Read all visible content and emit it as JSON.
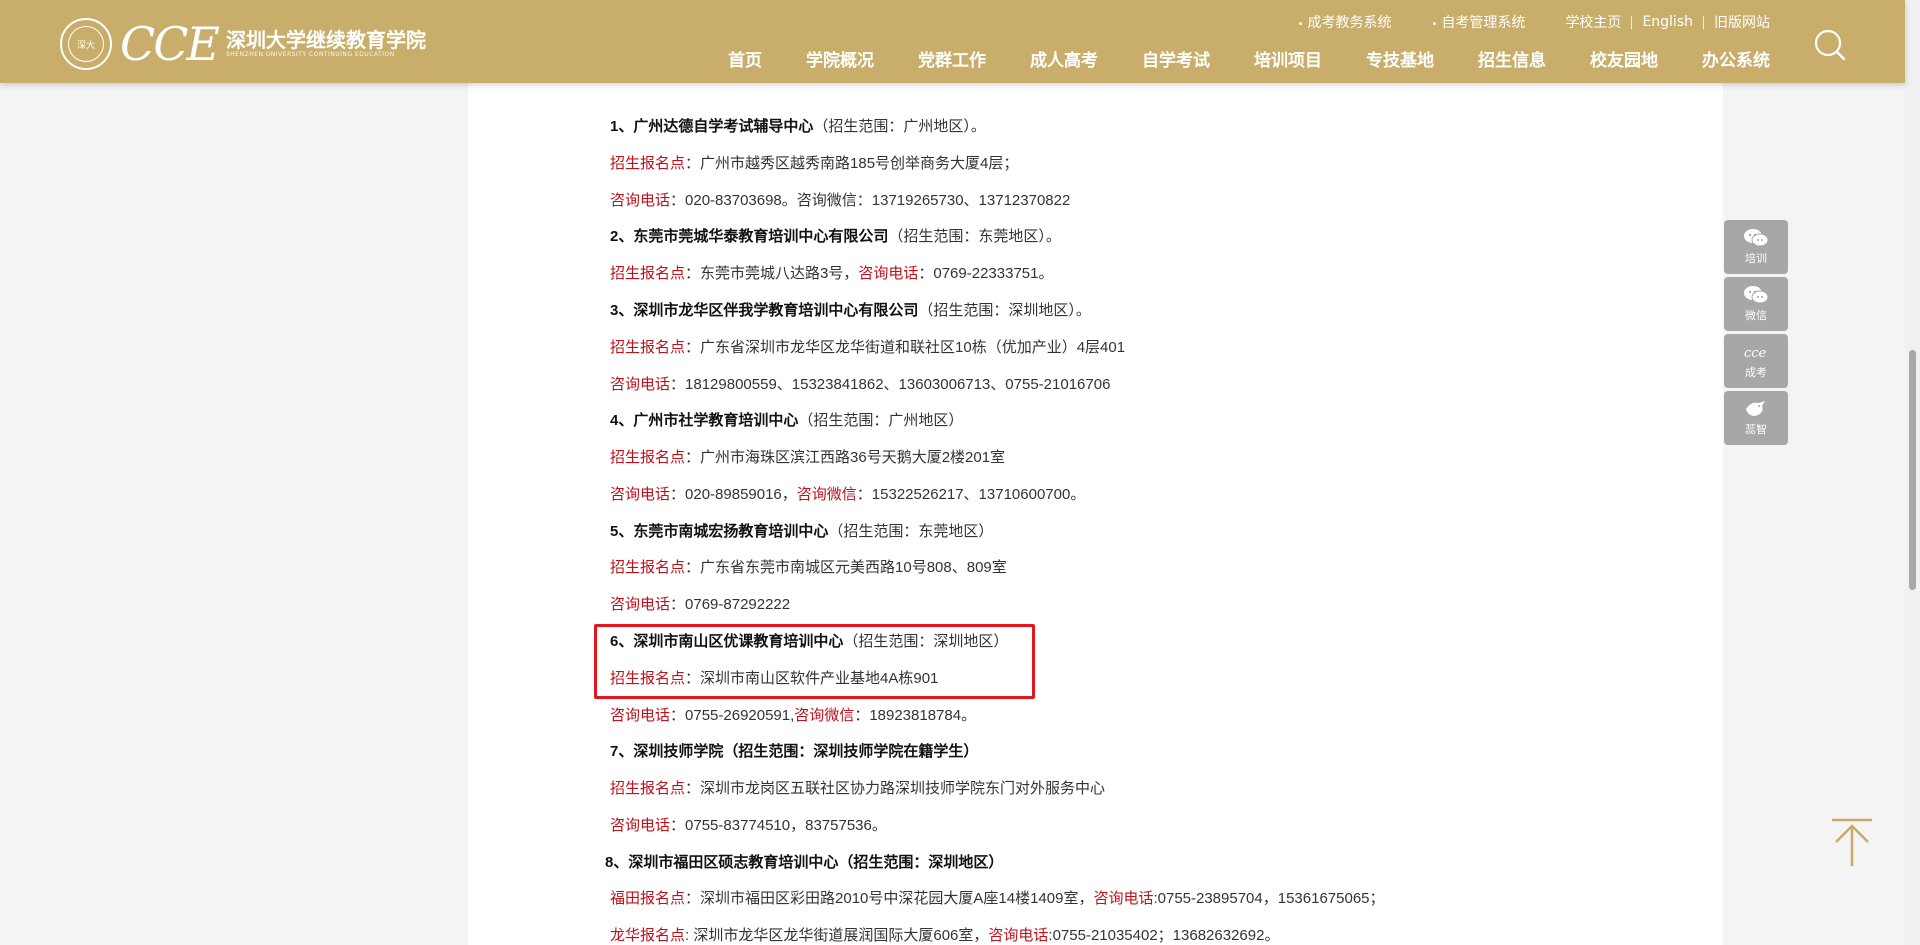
{
  "header": {
    "logo_cce": "CCE",
    "logo_seal": "深大",
    "logo_cn": "深圳大学继续教育学院",
    "logo_en": "SHENZHEN UNIVERSITY CONTINUING EDUCATION",
    "top_links": [
      "成考教务系统",
      "自考管理系统",
      "学校主页",
      "English",
      "旧版网站"
    ],
    "nav": [
      "首页",
      "学院概况",
      "党群工作",
      "成人高考",
      "自学考试",
      "培训项目",
      "专技基地",
      "招生信息",
      "校友园地",
      "办公系统"
    ]
  },
  "content": {
    "lines": [
      {
        "t": "1、广州达德自学考试辅导中心",
        "s": "（招生范围：广州地区）。"
      },
      {
        "r": "招生报名点",
        "s": "：广州市越秀区越秀南路185号创举商务大厦4层；"
      },
      {
        "r": "咨询电话",
        "s": "：020-83703698。咨询微信：13719265730、13712370822"
      },
      {
        "t": "2、东莞市莞城华泰教育培训中心有限公司",
        "s": "（招生范围：东莞地区）。"
      },
      {
        "r": "招生报名点",
        "s": "：东莞市莞城八达路3号，",
        "r2": "咨询电话",
        "s2": "：0769-22333751。"
      },
      {
        "t": "3、深圳市龙华区伴我学教育培训中心有限公司",
        "s": "（招生范围：深圳地区）。"
      },
      {
        "r": "招生报名点",
        "s": "：广东省深圳市龙华区龙华街道和联社区10栋（优加产业）4层401"
      },
      {
        "r": "咨询电话",
        "s": "：18129800559、15323841862、13603006713、0755-21016706"
      },
      {
        "t": "4、广州市社学教育培训中心",
        "s": "（招生范围：广州地区）"
      },
      {
        "r": "招生报名点",
        "s": "：广州市海珠区滨江西路36号天鹅大厦2楼201室"
      },
      {
        "r": "咨询电话",
        "s": "：020-89859016，",
        "r2": "咨询微信",
        "s2": "：15322526217、13710600700。"
      },
      {
        "t": "5、东莞市南城宏扬教育培训中心",
        "s": "（招生范围：东莞地区）"
      },
      {
        "r": "招生报名点",
        "s": "：广东省东莞市南城区元美西路10号808、809室"
      },
      {
        "r": "咨询电话",
        "s": "：0769-87292222"
      },
      {
        "t": "6、深圳市南山区优课教育培训中心",
        "s": "（招生范围：深圳地区）"
      },
      {
        "r": "招生报名点",
        "s": "：深圳市南山区软件产业基地4A栋901"
      },
      {
        "r": "咨询电话",
        "s": "：0755-26920591,",
        "r2": "咨询微信",
        "s2": "：18923818784。"
      },
      {
        "t": "7、深圳技师学院（招生范围：深圳技师学院在籍学生）",
        "s": ""
      },
      {
        "r": "招生报名点",
        "s": "：深圳市龙岗区五联社区协力路深圳技师学院东门对外服务中心"
      },
      {
        "r": "咨询电话",
        "s": "：0755-83774510，83757536。"
      },
      {
        "t": "8、深圳市福田区硕志教育培训中心（招生范围：深圳地区）",
        "s": ""
      },
      {
        "r": "福田报名点",
        "s": "：深圳市福田区彩田路2010号中深花园大厦A座14楼1409室，",
        "r2": "咨询电话",
        "s2": ":0755-23895704，15361675065；"
      },
      {
        "r": "龙华报名点",
        "s": ": 深圳市龙华区龙华街道展润国际大厦606室，",
        "r2": "咨询电话",
        "s2": ":0755-21035402；13682632692。"
      }
    ]
  },
  "side_buttons": [
    {
      "label": "培训",
      "icon": "wechat-icon"
    },
    {
      "label": "微信",
      "icon": "wechat-icon"
    },
    {
      "label": "成考",
      "icon": "cce-icon"
    },
    {
      "label": "蕊智",
      "icon": "bird-icon"
    }
  ],
  "colors": {
    "header": "#c9ae6b",
    "accent_red": "#c0101a",
    "highlight_border": "#e1161f"
  }
}
